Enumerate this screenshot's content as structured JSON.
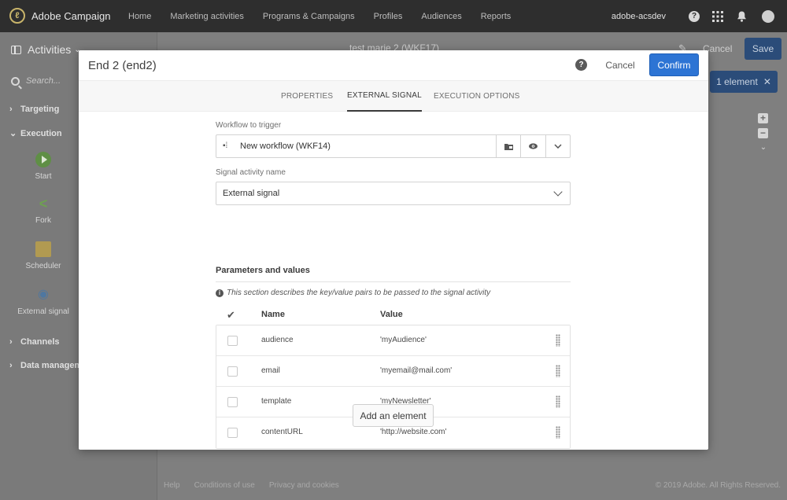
{
  "topbar": {
    "brand": "Adobe Campaign",
    "nav": [
      "Home",
      "Marketing activities",
      "Programs & Campaigns",
      "Profiles",
      "Audiences",
      "Reports"
    ],
    "user": "adobe-acsdev"
  },
  "sidebar": {
    "title": "Activities",
    "search_placeholder": "Search...",
    "categories": {
      "targeting": "Targeting",
      "execution": "Execution",
      "channels": "Channels",
      "data_management": "Data management"
    },
    "activities": [
      "Start",
      "Fork",
      "Scheduler",
      "External signal"
    ]
  },
  "canvas": {
    "workflow_title": "test marie 2 (WKF17)",
    "cancel_label": "Cancel",
    "save_label": "Save",
    "elements_label": "1 element"
  },
  "footer": {
    "links": [
      "Help",
      "Conditions of use",
      "Privacy and cookies"
    ],
    "copyright": "© 2019 Adobe. All Rights Reserved."
  },
  "modal": {
    "title": "End 2 (end2)",
    "cancel_label": "Cancel",
    "confirm_label": "Confirm",
    "tabs": [
      "PROPERTIES",
      "EXTERNAL SIGNAL",
      "EXECUTION OPTIONS"
    ],
    "active_tab": 1,
    "workflow_label": "Workflow to trigger",
    "workflow_value": "New workflow (WKF14)",
    "signal_label": "Signal activity name",
    "signal_value": "External signal",
    "params_heading": "Parameters and values",
    "params_info": "This section describes the key/value pairs to be passed to the signal activity",
    "columns": {
      "name": "Name",
      "value": "Value"
    },
    "rows": [
      {
        "name": "audience",
        "value": "'myAudience'"
      },
      {
        "name": "email",
        "value": "'myemail@mail.com'"
      },
      {
        "name": "template",
        "value": "'myNewsletter'"
      },
      {
        "name": "contentURL",
        "value": "'http://website.com'"
      }
    ],
    "add_element_label": "Add an element"
  },
  "colors": {
    "topbar": "#2e2e2e",
    "primary_button": "#2d74d4",
    "overlay": "#7f7f7f"
  }
}
